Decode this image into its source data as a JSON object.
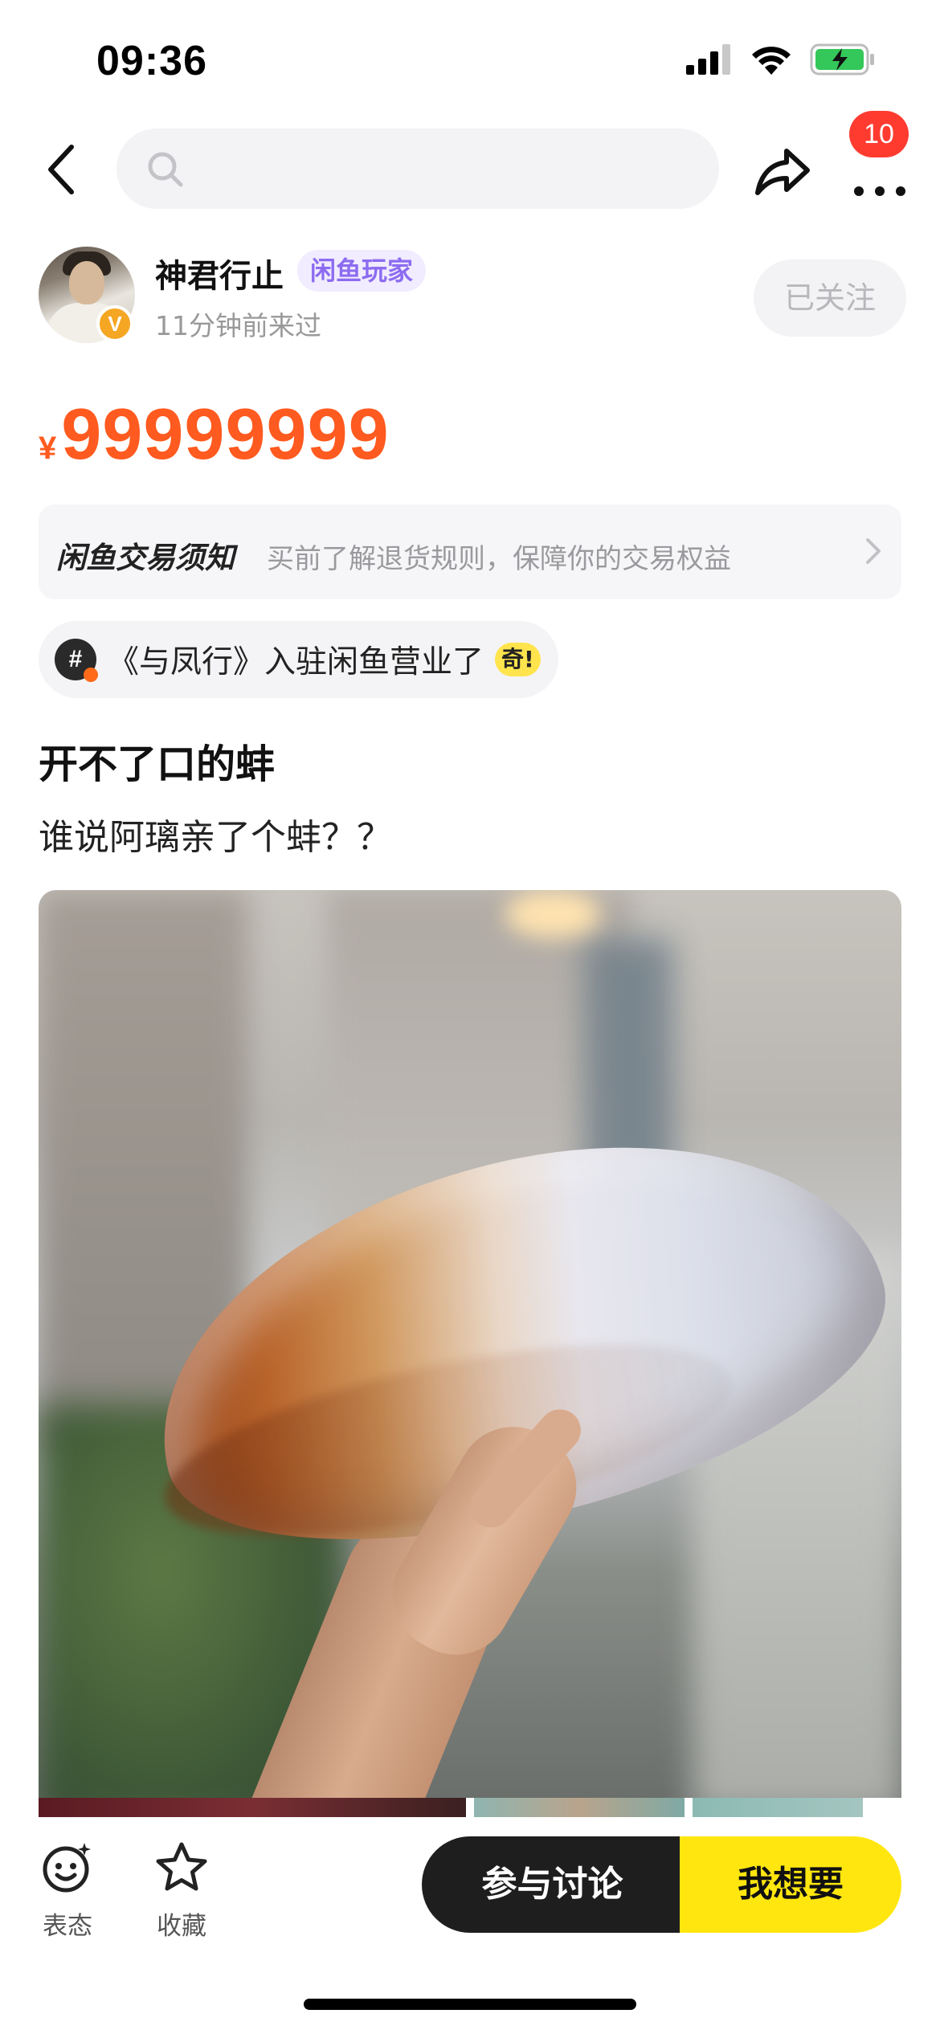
{
  "status_bar": {
    "time": "09:36"
  },
  "header": {
    "search_placeholder": "",
    "badge_count": "10"
  },
  "seller": {
    "name": "神君行止",
    "tag": "闲鱼玩家",
    "visit": "11分钟前来过",
    "follow_label": "已关注",
    "verified_mark": "V"
  },
  "price": {
    "symbol": "¥",
    "value": "99999999"
  },
  "notice": {
    "title": "闲鱼交易须知",
    "text": "买前了解退货规则，保障你的交易权益"
  },
  "topic": {
    "icon_label": "#",
    "text": "《与凤行》入驻闲鱼营业了",
    "emoji": "奇!"
  },
  "post": {
    "title": "开不了口的蚌",
    "description": "谁说阿璃亲了个蚌？？"
  },
  "bottom_bar": {
    "react_label": "表态",
    "favorite_label": "收藏",
    "discuss_label": "参与讨论",
    "want_label": "我想要"
  },
  "colors": {
    "price": "#ff5a1f",
    "want_button": "#ffe60f",
    "discuss_button": "#1e1e1e",
    "badge": "#ff3b30",
    "player_tag": "#8c6cf0"
  }
}
